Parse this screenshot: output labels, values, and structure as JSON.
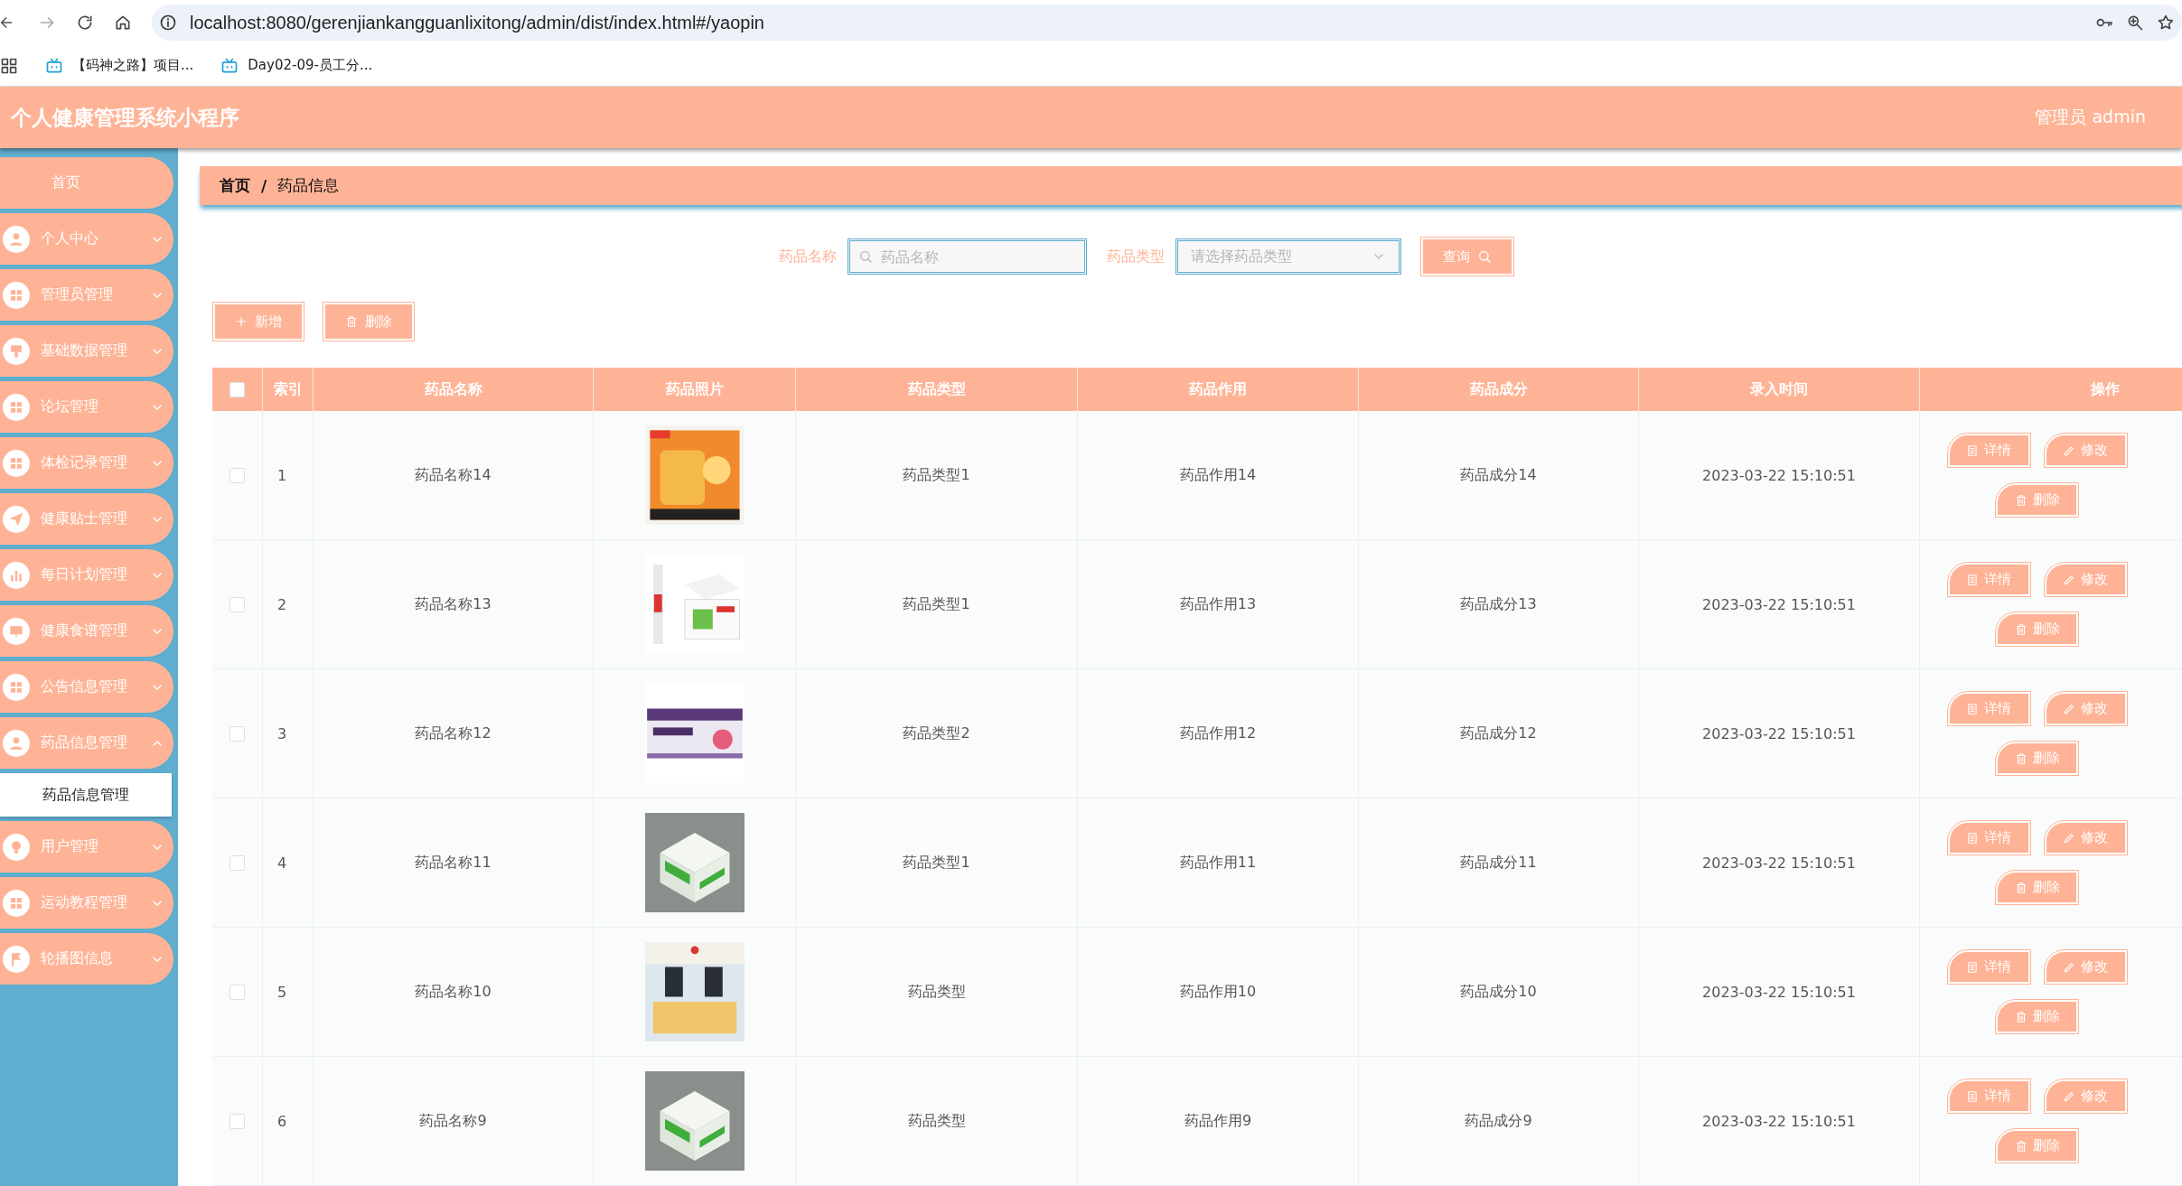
{
  "browser": {
    "url": "localhost:8080/gerenjiankangguanlixitong/admin/dist/index.html#/yaopin",
    "bookmarks": [
      "【码神之路】项目...",
      "Day02-09-员工分..."
    ]
  },
  "header": {
    "title": "个人健康管理系统小程序",
    "user": "管理员 admin"
  },
  "sidebar": {
    "items": [
      {
        "label": "首页",
        "kind": "link"
      },
      {
        "label": "个人中心",
        "kind": "group",
        "expanded": false
      },
      {
        "label": "管理员管理",
        "kind": "group",
        "expanded": false
      },
      {
        "label": "基础数据管理",
        "kind": "group",
        "expanded": false
      },
      {
        "label": "论坛管理",
        "kind": "group",
        "expanded": false
      },
      {
        "label": "体检记录管理",
        "kind": "group",
        "expanded": false
      },
      {
        "label": "健康贴士管理",
        "kind": "group",
        "expanded": false
      },
      {
        "label": "每日计划管理",
        "kind": "group",
        "expanded": false
      },
      {
        "label": "健康食谱管理",
        "kind": "group",
        "expanded": false
      },
      {
        "label": "公告信息管理",
        "kind": "group",
        "expanded": false
      },
      {
        "label": "药品信息管理",
        "kind": "group",
        "expanded": true,
        "children": [
          "药品信息管理"
        ]
      },
      {
        "label": "用户管理",
        "kind": "group",
        "expanded": false
      },
      {
        "label": "运动教程管理",
        "kind": "group",
        "expanded": false
      },
      {
        "label": "轮播图信息",
        "kind": "group",
        "expanded": false
      }
    ]
  },
  "breadcrumb": [
    "首页",
    "/",
    "药品信息"
  ],
  "search": {
    "name_label": "药品名称",
    "name_placeholder": "药品名称",
    "type_label": "药品类型",
    "type_placeholder": "请选择药品类型",
    "query_button": "查询"
  },
  "actions": [
    "新增",
    "删除"
  ],
  "table": {
    "all_checked": false,
    "columns": [
      "索引",
      "药品名称",
      "药品照片",
      "药品类型",
      "药品作用",
      "药品成分",
      "录入时间",
      "操作"
    ],
    "rows": [
      {
        "checked": false,
        "index": "1",
        "name": "药品名称14",
        "type": "药品类型1",
        "effect": "药品作用14",
        "ingredient": "药品成分14",
        "time": "2023-03-22 15:10:51",
        "buttons": [
          "详情",
          "修改",
          "删除"
        ]
      },
      {
        "checked": false,
        "index": "2",
        "name": "药品名称13",
        "type": "药品类型1",
        "effect": "药品作用13",
        "ingredient": "药品成分13",
        "time": "2023-03-22 15:10:51",
        "buttons": [
          "详情",
          "修改",
          "删除"
        ]
      },
      {
        "checked": false,
        "index": "3",
        "name": "药品名称12",
        "type": "药品类型2",
        "effect": "药品作用12",
        "ingredient": "药品成分12",
        "time": "2023-03-22 15:10:51",
        "buttons": [
          "详情",
          "修改",
          "删除"
        ]
      },
      {
        "checked": false,
        "index": "4",
        "name": "药品名称11",
        "type": "药品类型1",
        "effect": "药品作用11",
        "ingredient": "药品成分11",
        "time": "2023-03-22 15:10:51",
        "buttons": [
          "详情",
          "修改",
          "删除"
        ]
      },
      {
        "checked": false,
        "index": "5",
        "name": "药品名称10",
        "type": "药品类型",
        "effect": "药品作用10",
        "ingredient": "药品成分10",
        "time": "2023-03-22 15:10:51",
        "buttons": [
          "详情",
          "修改",
          "删除"
        ]
      },
      {
        "checked": false,
        "index": "6",
        "name": "药品名称9",
        "type": "药品类型",
        "effect": "药品作用9",
        "ingredient": "药品成分9",
        "time": "2023-03-22 15:10:51",
        "buttons": [
          "详情",
          "修改",
          "删除"
        ]
      }
    ]
  }
}
